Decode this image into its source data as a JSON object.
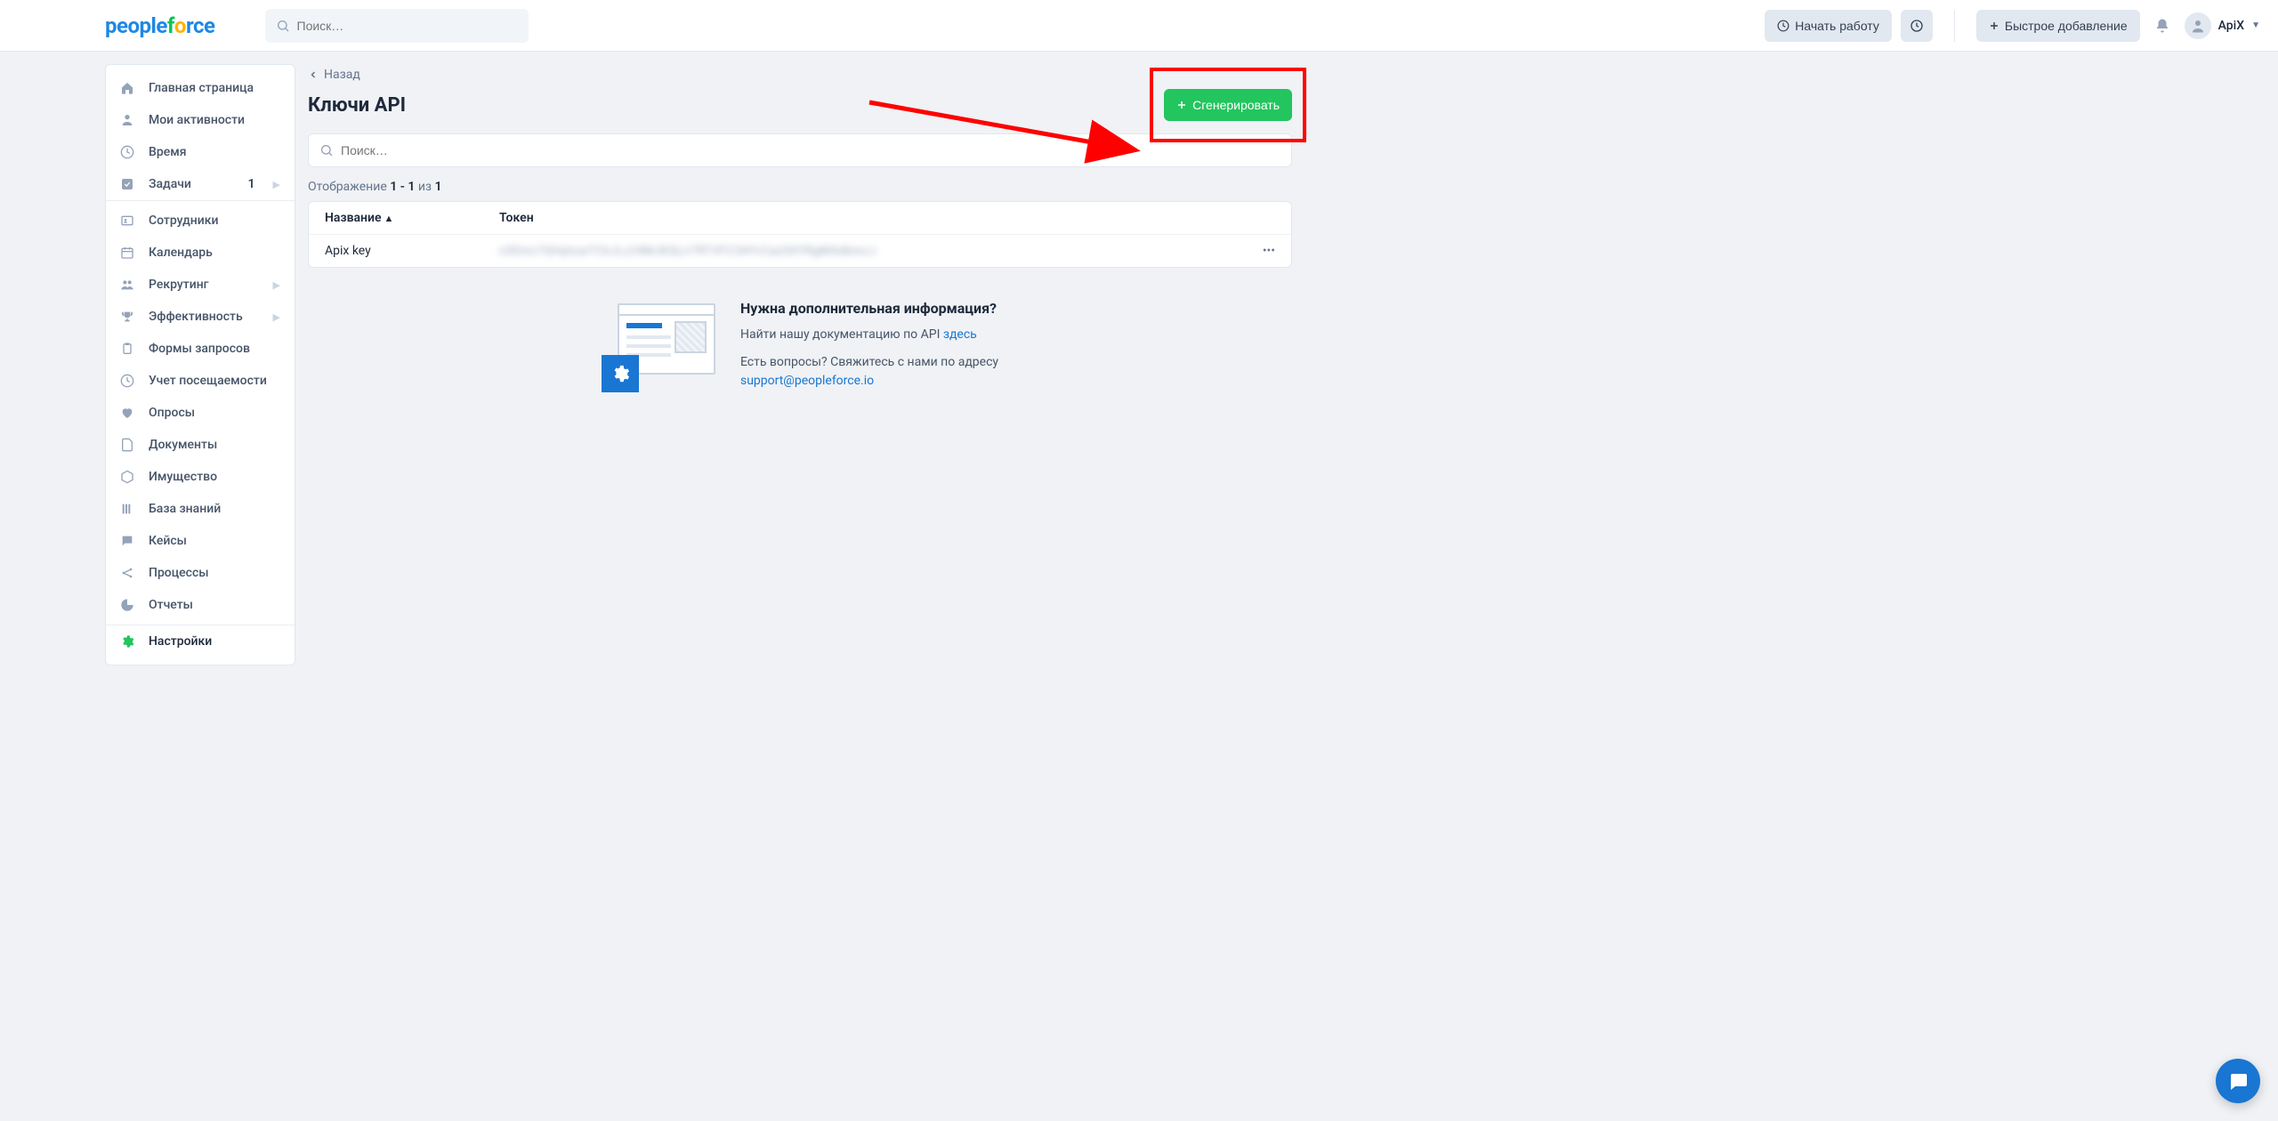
{
  "header": {
    "search_placeholder": "Поиск…",
    "start_label": "Начать работу",
    "quick_add_label": "Быстрое добавление",
    "user_name": "ApiX"
  },
  "sidebar": {
    "items": [
      {
        "label": "Главная страница"
      },
      {
        "label": "Мои активности"
      },
      {
        "label": "Время"
      },
      {
        "label": "Задачи",
        "badge": "1",
        "chevron": true
      },
      {
        "label": "Сотрудники"
      },
      {
        "label": "Календарь"
      },
      {
        "label": "Рекрутинг",
        "chevron": true
      },
      {
        "label": "Эффективность",
        "chevron": true
      },
      {
        "label": "Формы запросов"
      },
      {
        "label": "Учет посещаемости"
      },
      {
        "label": "Опросы"
      },
      {
        "label": "Документы"
      },
      {
        "label": "Имущество"
      },
      {
        "label": "База знаний"
      },
      {
        "label": "Кейсы"
      },
      {
        "label": "Процессы"
      },
      {
        "label": "Отчеты"
      },
      {
        "label": "Настройки"
      }
    ]
  },
  "page": {
    "back_label": "Назад",
    "title": "Ключи API",
    "generate_label": "Сгенерировать",
    "search_placeholder": "Поиск…",
    "tally_prefix": "Отображение",
    "tally_range": "1 - 1",
    "tally_mid": "из",
    "tally_total": "1",
    "columns": {
      "name": "Название",
      "token": "Токен"
    },
    "rows": [
      {
        "name": "Apix key",
        "token": "x3Dmc7QHptuwTCkJLx24MJKQLn7RTVFC34YvCazSXYRgMAdbmcJ"
      }
    ]
  },
  "info": {
    "heading": "Нужна дополнительная информация?",
    "doc_text": "Найти нашу документацию по API ",
    "doc_link": "здесь",
    "contact_text": "Есть вопросы? Свяжитесь с нами по адресу",
    "contact_email": "support@peopleforce.io"
  }
}
